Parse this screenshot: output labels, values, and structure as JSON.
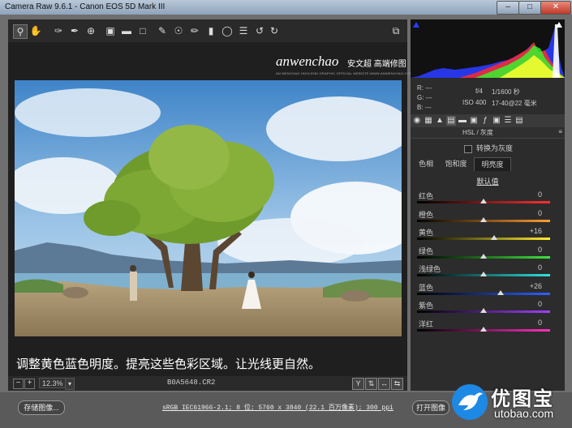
{
  "window": {
    "title": "Camera Raw 9.6.1 - Canon EOS 5D Mark III",
    "min": "–",
    "max": "□",
    "close": "✕"
  },
  "toolbar": {
    "tools": [
      "zoom-icon",
      "hand-icon",
      "white-balance-icon",
      "color-sampler-icon",
      "target-adjust-icon",
      "crop-icon",
      "straighten-icon",
      "transform-icon",
      "spot-removal-icon",
      "red-eye-icon",
      "adjustment-brush-icon",
      "graduated-filter-icon",
      "radial-filter-icon",
      "preferences-icon",
      "rotate-ccw-icon",
      "rotate-cw-icon",
      "fullscreen-icon"
    ]
  },
  "watermark": {
    "logo": "anwenchao",
    "name": "安文超 高端修图",
    "sub": "AN WENCHAO HIGH-END GRAPHIC OFFICIAL WEBSITE:WWW.ANWENCHAO.COM"
  },
  "caption": "调整黄色蓝色明度。提亮这些色彩区域。让光线更自然。",
  "zoom": {
    "value": "12.3%",
    "minus": "−",
    "plus": "+",
    "arrow": "▾"
  },
  "filename": "B0A5648.CR2",
  "view_buttons": [
    "Y",
    "⇅",
    "↔",
    "⇆"
  ],
  "info": {
    "r": "R:  ---",
    "g": "G:  ---",
    "b": "B:  ---",
    "aperture": "f/4",
    "shutter": "1/1600 秒",
    "iso": "ISO 400",
    "lens": "17-40@22 毫米"
  },
  "panel": {
    "icons": [
      "basic-icon",
      "tone-curve-icon",
      "detail-icon",
      "hsl-icon",
      "split-toning-icon",
      "lens-icon",
      "effects-icon",
      "camera-calibration-icon",
      "presets-icon",
      "snapshots-icon"
    ],
    "header": "HSL / 灰度",
    "menu": "≡",
    "grayscale": "转换为灰度",
    "subtabs": [
      "色相",
      "饱和度",
      "明亮度"
    ],
    "active_subtab": 2,
    "defaults": "默认值",
    "sliders": [
      {
        "label": "红色",
        "value": "0",
        "level": 0,
        "colors": [
          "#000000",
          "#ff3030"
        ]
      },
      {
        "label": "橙色",
        "value": "0",
        "level": 0,
        "colors": [
          "#000000",
          "#ff9a30"
        ]
      },
      {
        "label": "黄色",
        "value": "+16",
        "level": 16,
        "colors": [
          "#000000",
          "#ffee30"
        ]
      },
      {
        "label": "绿色",
        "value": "0",
        "level": 0,
        "colors": [
          "#000000",
          "#40e040"
        ]
      },
      {
        "label": "浅绿色",
        "value": "0",
        "level": 0,
        "colors": [
          "#000000",
          "#30e0e0"
        ]
      },
      {
        "label": "蓝色",
        "value": "+26",
        "level": 26,
        "colors": [
          "#000000",
          "#3060ff"
        ]
      },
      {
        "label": "紫色",
        "value": "0",
        "level": 0,
        "colors": [
          "#000000",
          "#a040ff"
        ]
      },
      {
        "label": "洋红",
        "value": "0",
        "level": 0,
        "colors": [
          "#000000",
          "#ff30c0"
        ]
      }
    ]
  },
  "bottom": {
    "save": "存储图像...",
    "workflow": "sRGB IEC61966-2.1; 8 位; 5760 x 3840 (22.1 百万像素); 300 ppi",
    "open": "打开图像"
  },
  "brand": {
    "cn": "优图宝",
    "en": "utobao.com"
  }
}
